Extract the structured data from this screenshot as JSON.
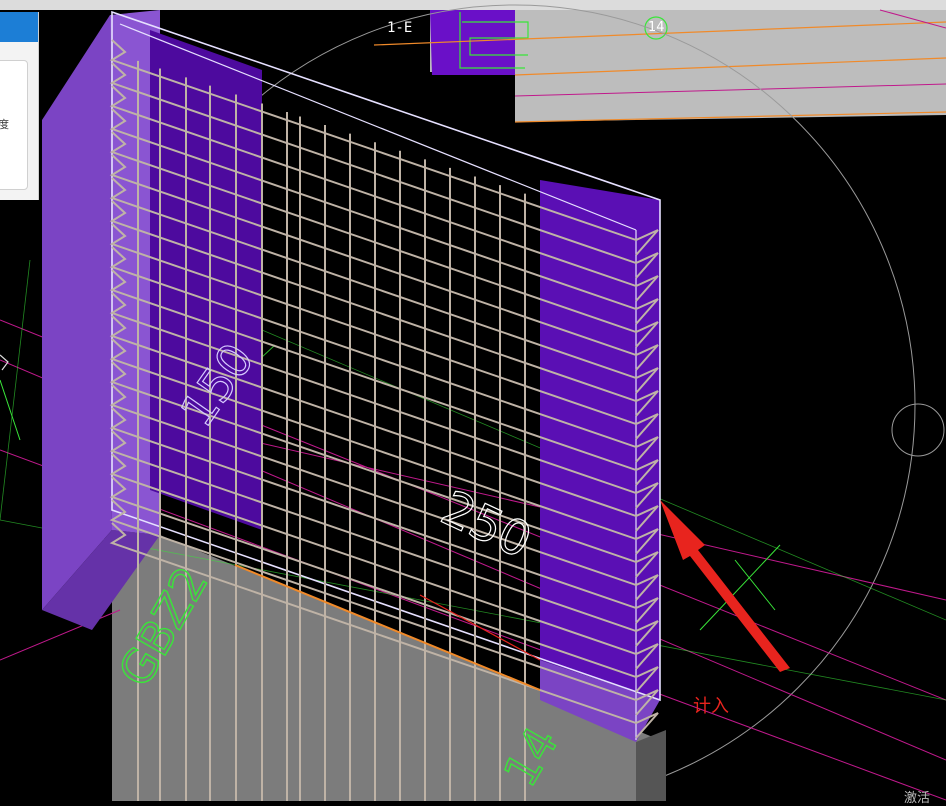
{
  "panel": {
    "label": "度"
  },
  "labels": {
    "axis_top": "1-E",
    "axis_bubble": "14",
    "annotation": "计入",
    "corner_text": "激活"
  },
  "colors": {
    "background": "#000000",
    "column_purple": "#7b44c4",
    "wall_purple": "#5a0fb4",
    "rebar": "#bfb3a6",
    "axis_green": "#39e639",
    "grid_magenta": "#c0198c",
    "annotation_red": "#e8241e",
    "slab_gray": "#b9b9b9",
    "edge_orange": "#f08a2a"
  }
}
